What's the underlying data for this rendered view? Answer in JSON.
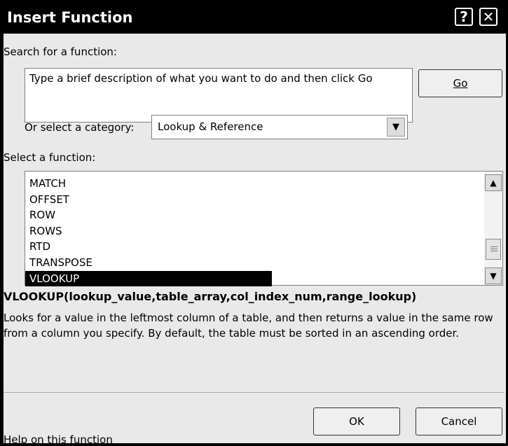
{
  "window": {
    "title": "Insert Function",
    "help_glyph": "?",
    "close_glyph": "✕"
  },
  "search": {
    "label": "Search for a function:",
    "value": "Type a brief description of what you want to do and then click Go",
    "go_label": "Go"
  },
  "category": {
    "label": "Or select a category:",
    "value": "Lookup & Reference"
  },
  "functions": {
    "label": "Select a function:",
    "items": [
      "MATCH",
      "OFFSET",
      "ROW",
      "ROWS",
      "RTD",
      "TRANSPOSE",
      "VLOOKUP"
    ],
    "selected": "VLOOKUP"
  },
  "details": {
    "syntax": "VLOOKUP(lookup_value,table_array,col_index_num,range_lookup)",
    "description": "Looks for a value in the leftmost column of a table, and then returns a value in the same row from a column you specify. By default, the table must be sorted in an ascending order."
  },
  "footer": {
    "help_link": "Help on this function",
    "ok_label": "OK",
    "cancel_label": "Cancel"
  }
}
